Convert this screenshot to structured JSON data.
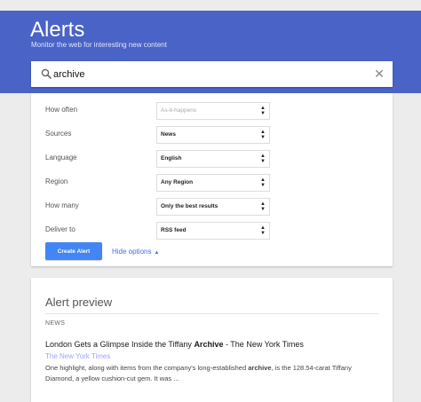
{
  "header": {
    "title": "Alerts",
    "subtitle": "Monitor the web for interesting new content",
    "brand_color": "#4a63c6"
  },
  "search": {
    "value": "archive",
    "clear_icon": "close-icon",
    "search_icon": "search-icon"
  },
  "options": {
    "rows": [
      {
        "label": "How often",
        "value": "As-it-happens",
        "disabled": true
      },
      {
        "label": "Sources",
        "value": "News",
        "disabled": false
      },
      {
        "label": "Language",
        "value": "English",
        "disabled": false
      },
      {
        "label": "Region",
        "value": "Any Region",
        "disabled": false
      },
      {
        "label": "How many",
        "value": "Only the best results",
        "disabled": false
      },
      {
        "label": "Deliver to",
        "value": "RSS feed",
        "disabled": false
      }
    ],
    "create_label": "Create Alert",
    "hide_label": "Hide options",
    "accent_color": "#4285f4"
  },
  "preview": {
    "title": "Alert preview",
    "section": "NEWS",
    "result": {
      "title_before": "London Gets a Glimpse Inside the Tiffany ",
      "title_bold": "Archive",
      "title_after": " - The New York Times",
      "source": "The New York Times",
      "snippet_before": "One highlight, along with items from the company's long-established ",
      "snippet_bold": "archive",
      "snippet_after": ", is the 128.54-carat Tiffany Diamond, a yellow cushion-cut gem. It was ..."
    }
  }
}
